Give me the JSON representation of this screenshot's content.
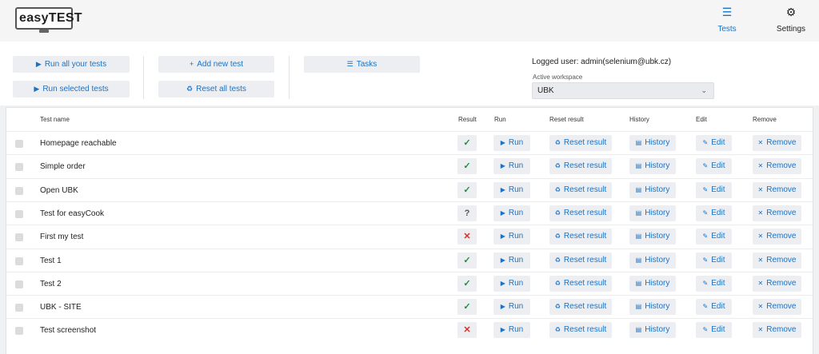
{
  "app": {
    "logo_text": "easyTEST"
  },
  "nav": {
    "tests": {
      "label": "Tests",
      "icon": "list-icon"
    },
    "settings": {
      "label": "Settings",
      "icon": "gear-icon"
    }
  },
  "toolbar": {
    "run_all": "Run all your tests",
    "run_selected": "Run selected tests",
    "add_new": "Add new test",
    "reset_all": "Reset all tests",
    "tasks": "Tasks"
  },
  "user": {
    "logged_user": "Logged user: admin(selenium@ubk.cz)",
    "workspace_label": "Active workspace",
    "workspace_value": "UBK"
  },
  "table": {
    "headers": [
      "Test name",
      "Result",
      "Run",
      "Reset result",
      "History",
      "Edit",
      "Remove"
    ],
    "actions": {
      "run": "Run",
      "reset": "Reset result",
      "history": "History",
      "edit": "Edit",
      "remove": "Remove"
    },
    "rows": [
      {
        "name": "Homepage reachable",
        "result": "pass"
      },
      {
        "name": "Simple order",
        "result": "pass"
      },
      {
        "name": "Open UBK",
        "result": "pass"
      },
      {
        "name": "Test for easyCook",
        "result": "unknown"
      },
      {
        "name": "First my test",
        "result": "fail"
      },
      {
        "name": "Test 1",
        "result": "pass"
      },
      {
        "name": "Test 2",
        "result": "pass"
      },
      {
        "name": "UBK - SITE",
        "result": "pass"
      },
      {
        "name": "Test screenshot",
        "result": "fail"
      }
    ]
  },
  "colors": {
    "accent": "#1a73c7",
    "pass": "#1e8e3e",
    "fail": "#d93025",
    "unknown": "#555555"
  }
}
